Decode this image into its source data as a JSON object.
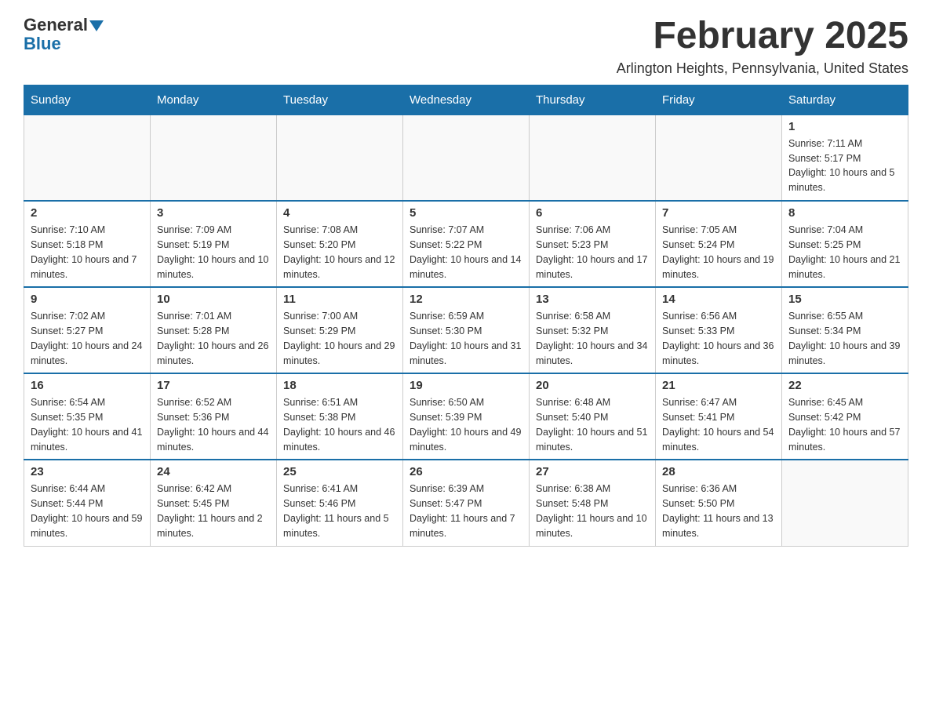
{
  "header": {
    "logo_general": "General",
    "logo_blue": "Blue",
    "month_title": "February 2025",
    "location": "Arlington Heights, Pennsylvania, United States"
  },
  "days_of_week": [
    "Sunday",
    "Monday",
    "Tuesday",
    "Wednesday",
    "Thursday",
    "Friday",
    "Saturday"
  ],
  "weeks": [
    [
      {
        "day": "",
        "info": ""
      },
      {
        "day": "",
        "info": ""
      },
      {
        "day": "",
        "info": ""
      },
      {
        "day": "",
        "info": ""
      },
      {
        "day": "",
        "info": ""
      },
      {
        "day": "",
        "info": ""
      },
      {
        "day": "1",
        "info": "Sunrise: 7:11 AM\nSunset: 5:17 PM\nDaylight: 10 hours and 5 minutes."
      }
    ],
    [
      {
        "day": "2",
        "info": "Sunrise: 7:10 AM\nSunset: 5:18 PM\nDaylight: 10 hours and 7 minutes."
      },
      {
        "day": "3",
        "info": "Sunrise: 7:09 AM\nSunset: 5:19 PM\nDaylight: 10 hours and 10 minutes."
      },
      {
        "day": "4",
        "info": "Sunrise: 7:08 AM\nSunset: 5:20 PM\nDaylight: 10 hours and 12 minutes."
      },
      {
        "day": "5",
        "info": "Sunrise: 7:07 AM\nSunset: 5:22 PM\nDaylight: 10 hours and 14 minutes."
      },
      {
        "day": "6",
        "info": "Sunrise: 7:06 AM\nSunset: 5:23 PM\nDaylight: 10 hours and 17 minutes."
      },
      {
        "day": "7",
        "info": "Sunrise: 7:05 AM\nSunset: 5:24 PM\nDaylight: 10 hours and 19 minutes."
      },
      {
        "day": "8",
        "info": "Sunrise: 7:04 AM\nSunset: 5:25 PM\nDaylight: 10 hours and 21 minutes."
      }
    ],
    [
      {
        "day": "9",
        "info": "Sunrise: 7:02 AM\nSunset: 5:27 PM\nDaylight: 10 hours and 24 minutes."
      },
      {
        "day": "10",
        "info": "Sunrise: 7:01 AM\nSunset: 5:28 PM\nDaylight: 10 hours and 26 minutes."
      },
      {
        "day": "11",
        "info": "Sunrise: 7:00 AM\nSunset: 5:29 PM\nDaylight: 10 hours and 29 minutes."
      },
      {
        "day": "12",
        "info": "Sunrise: 6:59 AM\nSunset: 5:30 PM\nDaylight: 10 hours and 31 minutes."
      },
      {
        "day": "13",
        "info": "Sunrise: 6:58 AM\nSunset: 5:32 PM\nDaylight: 10 hours and 34 minutes."
      },
      {
        "day": "14",
        "info": "Sunrise: 6:56 AM\nSunset: 5:33 PM\nDaylight: 10 hours and 36 minutes."
      },
      {
        "day": "15",
        "info": "Sunrise: 6:55 AM\nSunset: 5:34 PM\nDaylight: 10 hours and 39 minutes."
      }
    ],
    [
      {
        "day": "16",
        "info": "Sunrise: 6:54 AM\nSunset: 5:35 PM\nDaylight: 10 hours and 41 minutes."
      },
      {
        "day": "17",
        "info": "Sunrise: 6:52 AM\nSunset: 5:36 PM\nDaylight: 10 hours and 44 minutes."
      },
      {
        "day": "18",
        "info": "Sunrise: 6:51 AM\nSunset: 5:38 PM\nDaylight: 10 hours and 46 minutes."
      },
      {
        "day": "19",
        "info": "Sunrise: 6:50 AM\nSunset: 5:39 PM\nDaylight: 10 hours and 49 minutes."
      },
      {
        "day": "20",
        "info": "Sunrise: 6:48 AM\nSunset: 5:40 PM\nDaylight: 10 hours and 51 minutes."
      },
      {
        "day": "21",
        "info": "Sunrise: 6:47 AM\nSunset: 5:41 PM\nDaylight: 10 hours and 54 minutes."
      },
      {
        "day": "22",
        "info": "Sunrise: 6:45 AM\nSunset: 5:42 PM\nDaylight: 10 hours and 57 minutes."
      }
    ],
    [
      {
        "day": "23",
        "info": "Sunrise: 6:44 AM\nSunset: 5:44 PM\nDaylight: 10 hours and 59 minutes."
      },
      {
        "day": "24",
        "info": "Sunrise: 6:42 AM\nSunset: 5:45 PM\nDaylight: 11 hours and 2 minutes."
      },
      {
        "day": "25",
        "info": "Sunrise: 6:41 AM\nSunset: 5:46 PM\nDaylight: 11 hours and 5 minutes."
      },
      {
        "day": "26",
        "info": "Sunrise: 6:39 AM\nSunset: 5:47 PM\nDaylight: 11 hours and 7 minutes."
      },
      {
        "day": "27",
        "info": "Sunrise: 6:38 AM\nSunset: 5:48 PM\nDaylight: 11 hours and 10 minutes."
      },
      {
        "day": "28",
        "info": "Sunrise: 6:36 AM\nSunset: 5:50 PM\nDaylight: 11 hours and 13 minutes."
      },
      {
        "day": "",
        "info": ""
      }
    ]
  ]
}
